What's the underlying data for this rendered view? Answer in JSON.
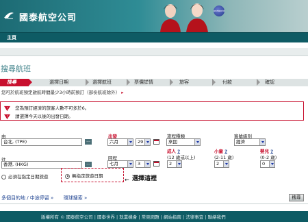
{
  "header": {
    "brand_name": "國泰航空公司",
    "oneworld_label": "oneworld",
    "colors": {
      "header_teal": "#1d6b74",
      "accent_red": "#c8102e",
      "nav_dark": "#0e5b64"
    }
  },
  "nav": {
    "home": "主頁"
  },
  "page_title": "搜尋航班",
  "steps": [
    "搜尋",
    "選擇日期",
    "選擇航班",
    "票價詳情",
    "旅客",
    "付款",
    "確認"
  ],
  "notice": "您可於航班預定啟航時間最少3小時前預訂（部份航班除外）",
  "errors": [
    "您為預訂經濟的旅客人數不可多於6。",
    "請選擇今天以後的出發日期。"
  ],
  "form": {
    "from_label": "由",
    "from_value": "台北, (TPE)",
    "to_label": "往",
    "to_value": "香港, (HKG)",
    "dots_button": "...",
    "depart_label": "出發",
    "depart_month": "六月",
    "depart_day": "29",
    "return_label": "回程",
    "return_month": "七月",
    "return_day": "3",
    "trip_type_label": "旅程種類",
    "trip_type_value": "來回",
    "cabin_label": "客艙級別",
    "cabin_value": "經濟",
    "adult_label": "成人",
    "adult_sub": "(12 歲或以上)",
    "adult_value": "2",
    "child_label": "小童",
    "child_sub": "(2-11 歲)",
    "child_value": "2",
    "infant_label": "嬰兒",
    "infant_sub": "(0-2 歲)",
    "infant_value": "0",
    "help_mark": "?",
    "fixed_dates_label": "必須在指定日期旅遊",
    "any_dates_label": "無指定旅遊日期",
    "annotation_arrow": "←",
    "annotation_text": "選擇這裡"
  },
  "links": {
    "multi_city": "多個目的地 / 中途停留 »",
    "reset": "環球搜索 »"
  },
  "search_button": "搜尋",
  "footer": "版權所有 © 國泰航空公司 | 國泰世界 | 就業機會 | 常見問題 | 網站指南 | 法律事宜 | 聯絡我們"
}
